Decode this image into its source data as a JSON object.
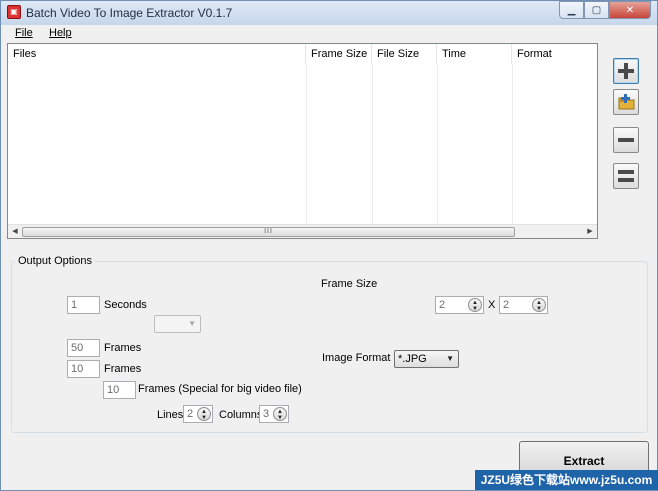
{
  "window": {
    "title": "Batch Video To Image Extractor V0.1.7",
    "app_icon_text": "▣"
  },
  "menu": {
    "file": "File",
    "help": "Help"
  },
  "file_list": {
    "columns": [
      "Files",
      "Frame Size",
      "File Size",
      "Time",
      "Format"
    ],
    "rows": [],
    "scrollbar_grip": "III"
  },
  "side_buttons": [
    {
      "name": "add-file-button",
      "icon": "plus-icon"
    },
    {
      "name": "add-folder-button",
      "icon": "folder-add-icon"
    },
    {
      "name": "remove-file-button",
      "icon": "minus-icon"
    },
    {
      "name": "clear-list-button",
      "icon": "clear-list-icon"
    }
  ],
  "output": {
    "group_title": "Output Options",
    "seconds_value": "1",
    "seconds_label": "Seconds",
    "frames1_value": "50",
    "frames1_label": "Frames",
    "frames2_value": "10",
    "frames2_label": "Frames",
    "frames3_value": "10",
    "frames3_label": "Frames (Special for big video file)",
    "lines_label": "Lines",
    "lines_value": "2",
    "columns_label": "Columns",
    "columns_value": "3",
    "frame_size_label": "Frame Size",
    "frame_width": "2",
    "frame_height": "2",
    "frame_sep": "X",
    "image_format_label": "Image Format",
    "image_format_value": "*.JPG",
    "unit_combo_value": ""
  },
  "extract_label": "Extract",
  "watermark": "JZ5U绿色下载站www.jz5u.com"
}
